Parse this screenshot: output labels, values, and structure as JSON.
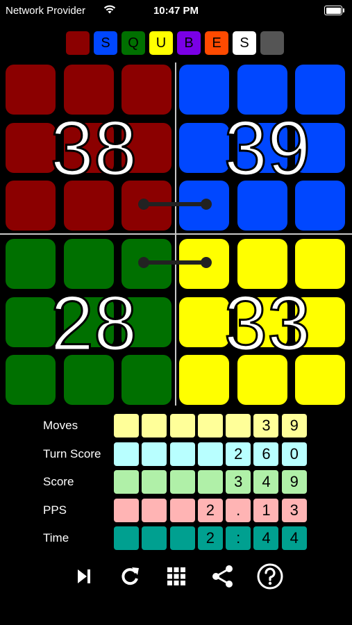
{
  "status_bar": {
    "carrier": "Network Provider",
    "time": "10:47 PM"
  },
  "title_tiles": [
    {
      "letter": "",
      "color": "#8b0000"
    },
    {
      "letter": "S",
      "color": "#0047ff"
    },
    {
      "letter": "Q",
      "color": "#007000"
    },
    {
      "letter": "U",
      "color": "#ffff00"
    },
    {
      "letter": "B",
      "color": "#7a00e6"
    },
    {
      "letter": "E",
      "color": "#ff4a00"
    },
    {
      "letter": "S",
      "color": "#ffffff"
    },
    {
      "letter": "",
      "color": "#555555"
    }
  ],
  "quadrants": {
    "top_left": {
      "score": "38",
      "color": "#8b0000"
    },
    "top_right": {
      "score": "39",
      "color": "#0047ff"
    },
    "bottom_left": {
      "score": "28",
      "color": "#007000"
    },
    "bottom_right": {
      "score": "33",
      "color": "#ffff00"
    }
  },
  "stats": [
    {
      "label": "Moves",
      "color": "#ffff99",
      "digits": [
        "",
        "",
        "",
        "",
        "",
        "3",
        "9"
      ]
    },
    {
      "label": "Turn Score",
      "color": "#b8ffff",
      "digits": [
        "",
        "",
        "",
        "",
        "2",
        "6",
        "0"
      ]
    },
    {
      "label": "Score",
      "color": "#b0f0a8",
      "digits": [
        "",
        "",
        "",
        "",
        "3",
        "4",
        "9"
      ]
    },
    {
      "label": "PPS",
      "color": "#ffb4b4",
      "digits": [
        "",
        "",
        "",
        "2",
        ".",
        "1",
        "3"
      ]
    },
    {
      "label": "Time",
      "color": "#00a090",
      "digits": [
        "",
        "",
        "",
        "2",
        ":",
        "4",
        "4"
      ]
    }
  ],
  "toolbar": [
    {
      "name": "skip-forward-icon"
    },
    {
      "name": "restart-icon"
    },
    {
      "name": "grid-icon"
    },
    {
      "name": "share-icon"
    },
    {
      "name": "help-icon"
    }
  ]
}
